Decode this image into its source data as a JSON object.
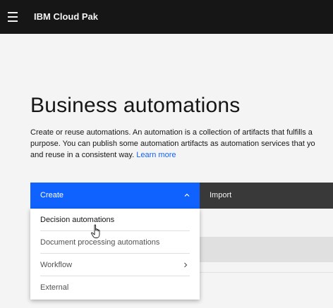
{
  "header": {
    "product_name": "IBM Cloud Pak",
    "menu_icon": "hamburger-menu-icon"
  },
  "page": {
    "title": "Business automations",
    "description_lines": [
      "Create or reuse automations. An automation is a collection of artifacts that fulfills a",
      "purpose. You can publish some automation artifacts as automation services that yo",
      "and reuse in a consistent way."
    ],
    "learn_more": "Learn more"
  },
  "tabs": {
    "create": "Create",
    "import": "Import"
  },
  "create_menu": {
    "items": [
      {
        "label": "Decision automations",
        "submenu": false
      },
      {
        "label": "Document processing automations",
        "submenu": false
      },
      {
        "label": "Workflow",
        "submenu": true
      },
      {
        "label": "External",
        "submenu": false
      }
    ]
  },
  "colors": {
    "topbar": "#161616",
    "accent": "#0f62fe",
    "import_tab": "#393939",
    "page_bg": "#f4f4f4"
  },
  "icons": {
    "create_chevron": "chevron-up-icon",
    "workflow_chevron": "chevron-right-icon",
    "cursor": "hand-pointer-cursor-icon"
  }
}
